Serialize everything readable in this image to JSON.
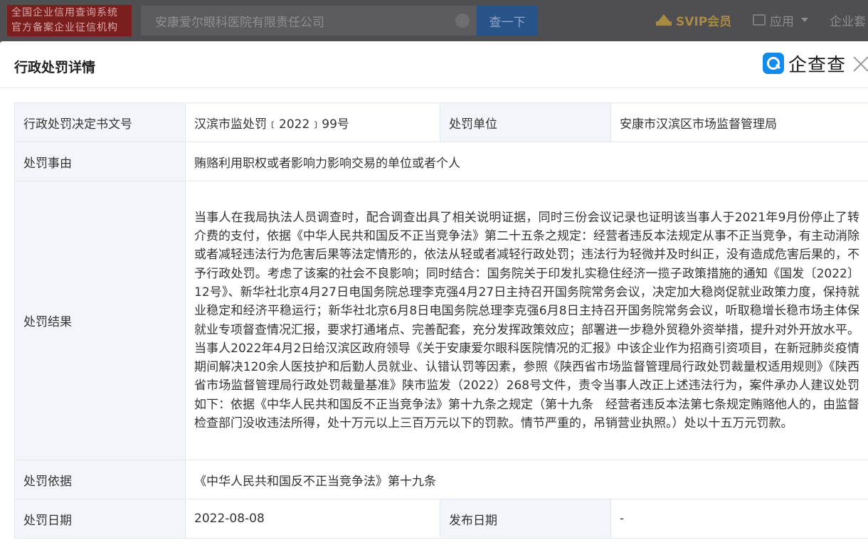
{
  "topbar": {
    "brand_line1": "全国企业信用查询系统",
    "brand_line2": "官方备案企业征信机构",
    "search_value": "安康爱尔眼科医院有限责任公司",
    "search_button": "查一下",
    "svip": "SVIP会员",
    "apps": "应用",
    "enterprise": "企业套"
  },
  "modal": {
    "title": "行政处罚详情",
    "logo_text": "企查查",
    "icons": {
      "logo": "qichacha-logo-icon",
      "close": "close-icon",
      "svip": "crown-icon",
      "apps": "apps-icon",
      "search_clear": "clear-icon"
    }
  },
  "details": {
    "doc_no_label": "行政处罚决定书文号",
    "doc_no_value": "汉滨市监处罚﹝2022﹞99号",
    "unit_label": "处罚单位",
    "unit_value": "安康市汉滨区市场监督管理局",
    "reason_label": "处罚事由",
    "reason_value": "贿赂利用职权或者影响力影响交易的单位或者个人",
    "result_label": "处罚结果",
    "result_value": "当事人在我局执法人员调查时，配合调查出具了相关说明证据，同时三份会议记录也证明该当事人于2021年9月份停止了转介费的支付，依据《中华人民共和国反不正当竞争法》第二十五条之规定：经营者违反本法规定从事不正当竞争，有主动消除或者减轻违法行为危害后果等法定情形的，依法从轻或者减轻行政处罚；违法行为轻微并及时纠正，没有造成危害后果的，不予行政处罚。考虑了该案的社会不良影响；同时结合：国务院关于印发扎实稳住经济一揽子政策措施的通知《国发〔2022〕12号》、新华社北京4月27日电国务院总理李克强4月27日主持召开国务院常务会议，决定加大稳岗促就业政策力度，保持就业稳定和经济平稳运行；新华社北京6月8日电国务院总理李克强6月8日主持召开国务院常务会议，听取稳增长稳市场主体保就业专项督查情况汇报，要求打通堵点、完善配套，充分发挥政策效应；部署进一步稳外贸稳外资举措，提升对外开放水平。当事人2022年4月2日给汉滨区政府领导《关于安康爱尔眼科医院情况的汇报》中该企业作为招商引资项目，在新冠肺炎疫情期间解决120余人医技护和后勤人员就业、认错认罚等因素，参照《陕西省市场监督管理局行政处罚裁量权适用规则》《陕西省市场监督管理局行政处罚裁量基准》陕市监发（2022）268号文件，责令当事人改正上述违法行为，案件承办人建议处罚如下：依据《中华人民共和国反不正当竞争法》第十九条之规定（第十九条　经营者违反本法第七条规定贿赂他人的，由监督检查部门没收违法所得，处十万元以上三百万元以下的罚款。情节严重的，吊销营业执照。）处以十五万元罚款。",
    "basis_label": "处罚依据",
    "basis_value": "《中华人民共和国反不正当竞争法》第十九条",
    "date_label": "处罚日期",
    "date_value": "2022-08-08",
    "publish_label": "发布日期",
    "publish_value": "-"
  }
}
